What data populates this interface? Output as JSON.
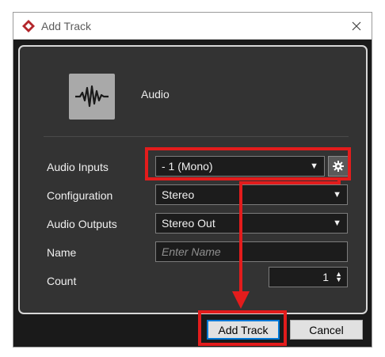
{
  "window": {
    "title": "Add Track",
    "close_icon": "close-icon",
    "app_icon": "cubase-logo-icon"
  },
  "track": {
    "type_label": "Audio",
    "type_icon": "waveform-icon"
  },
  "form": {
    "audio_inputs": {
      "label": "Audio Inputs",
      "value": "- 1 (Mono)"
    },
    "configuration": {
      "label": "Configuration",
      "value": "Stereo"
    },
    "audio_outputs": {
      "label": "Audio Outputs",
      "value": "Stereo Out"
    },
    "name": {
      "label": "Name",
      "value": "",
      "placeholder": "Enter Name"
    },
    "count": {
      "label": "Count",
      "value": "1"
    }
  },
  "buttons": {
    "add_track": "Add Track",
    "cancel": "Cancel"
  },
  "colors": {
    "highlight": "#e31c1c",
    "dialog_bg": "#333333",
    "focus": "#0078d7"
  }
}
